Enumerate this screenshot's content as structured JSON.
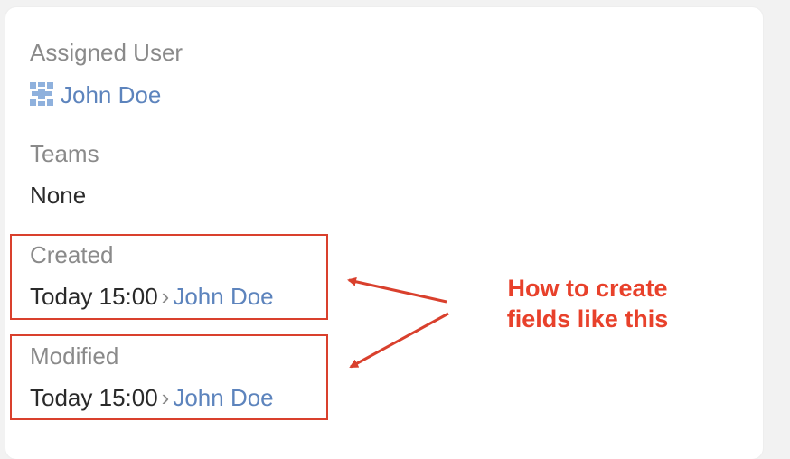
{
  "assigned_user": {
    "label": "Assigned User",
    "value": "John Doe",
    "icon": "user-avatar-icon"
  },
  "teams": {
    "label": "Teams",
    "value": "None"
  },
  "created": {
    "label": "Created",
    "date": "Today 15:00",
    "separator": "›",
    "user": "John Doe"
  },
  "modified": {
    "label": "Modified",
    "date": "Today 15:00",
    "separator": "›",
    "user": "John Doe"
  },
  "annotation": {
    "line1": "How to create",
    "line2": "fields like this",
    "color": "#e8412b"
  },
  "colors": {
    "link": "#5d84bd",
    "label": "#8a8a8a",
    "highlight": "#d9402d"
  }
}
